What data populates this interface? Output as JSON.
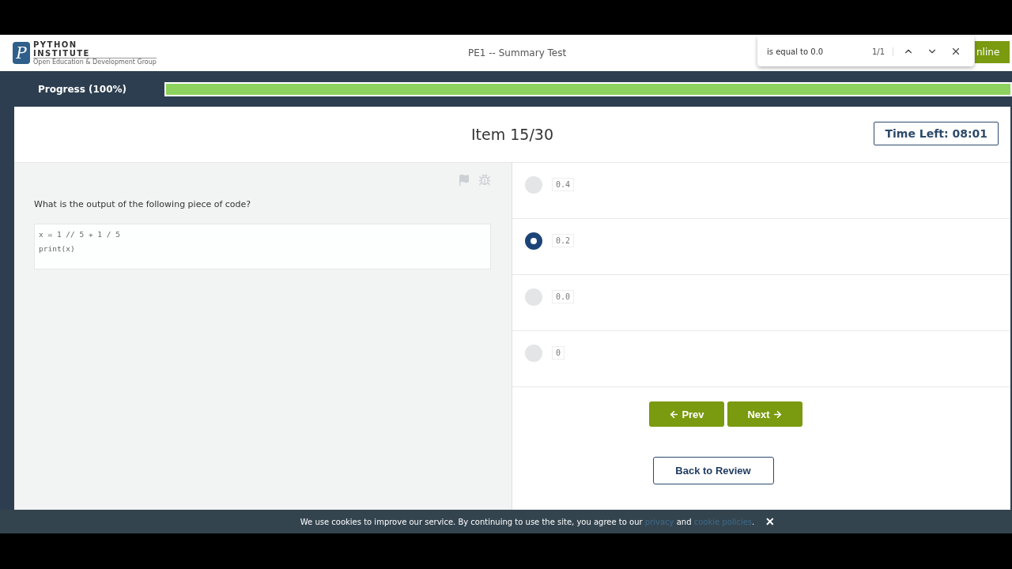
{
  "header": {
    "logo": {
      "mark": "P",
      "line1": "PYTHON",
      "line2": "INSTITUTE",
      "tagline": "Open Education & Development Group"
    },
    "title": "PE1 -- Summary Test",
    "button_label": "nline"
  },
  "find_bar": {
    "query": "is equal to 0.0",
    "count": "1/1"
  },
  "progress": {
    "label": "Progress (100%)",
    "level": 1
  },
  "item": {
    "title": "Item 15/30",
    "timer": "Time Left: 08:01"
  },
  "question": {
    "text": "What is the output of the following piece of code?",
    "code": [
      "x = 1 // 5 + 1 / 5",
      "print(x)"
    ]
  },
  "options": [
    {
      "label": "0.4",
      "selected": false
    },
    {
      "label": "0.2",
      "selected": true
    },
    {
      "label": "0.0",
      "selected": false
    },
    {
      "label": "0",
      "selected": false
    }
  ],
  "buttons": {
    "prev": "Prev",
    "next": "Next",
    "review": "Back to Review"
  },
  "cookie": {
    "text": "We use cookies to improve our service. By continuing to use the site, you agree to our",
    "link1": "privacy",
    "middle": "and",
    "link2": "cookie policies",
    "end": ".",
    "close": "✕"
  }
}
